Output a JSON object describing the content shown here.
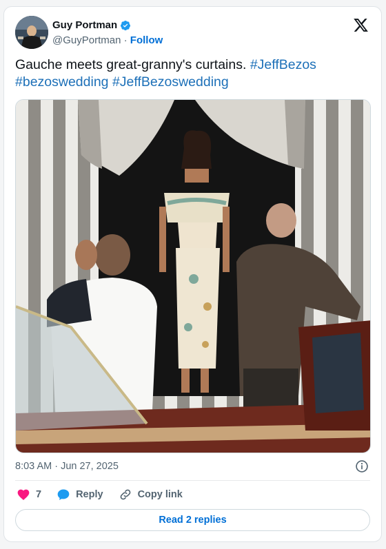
{
  "author": {
    "display_name": "Guy Portman",
    "handle": "@GuyPortman",
    "separator": "·",
    "follow_label": "Follow",
    "verified": true
  },
  "tweet": {
    "text_plain": "Gauche meets great-granny's curtains. ",
    "hashtags": [
      "#JeffBezos",
      "#bezoswedding",
      "#JeffBezoswedding"
    ]
  },
  "media": {
    "icon": "photo",
    "colors": {
      "curtain_light": "#e8e6e1",
      "curtain_dark": "#8d8a85",
      "boat_wood": "#6e2a1e"
    }
  },
  "meta": {
    "timestamp": "8:03 AM · Jun 27, 2025"
  },
  "actions": {
    "like_count": "7",
    "reply_label": "Reply",
    "copy_link_label": "Copy link"
  },
  "footer": {
    "read_replies_label": "Read 2 replies"
  },
  "colors": {
    "link": "#006fd6",
    "hashtag": "#1d70b8",
    "like": "#f91880",
    "verified": "#1d9bf0"
  }
}
